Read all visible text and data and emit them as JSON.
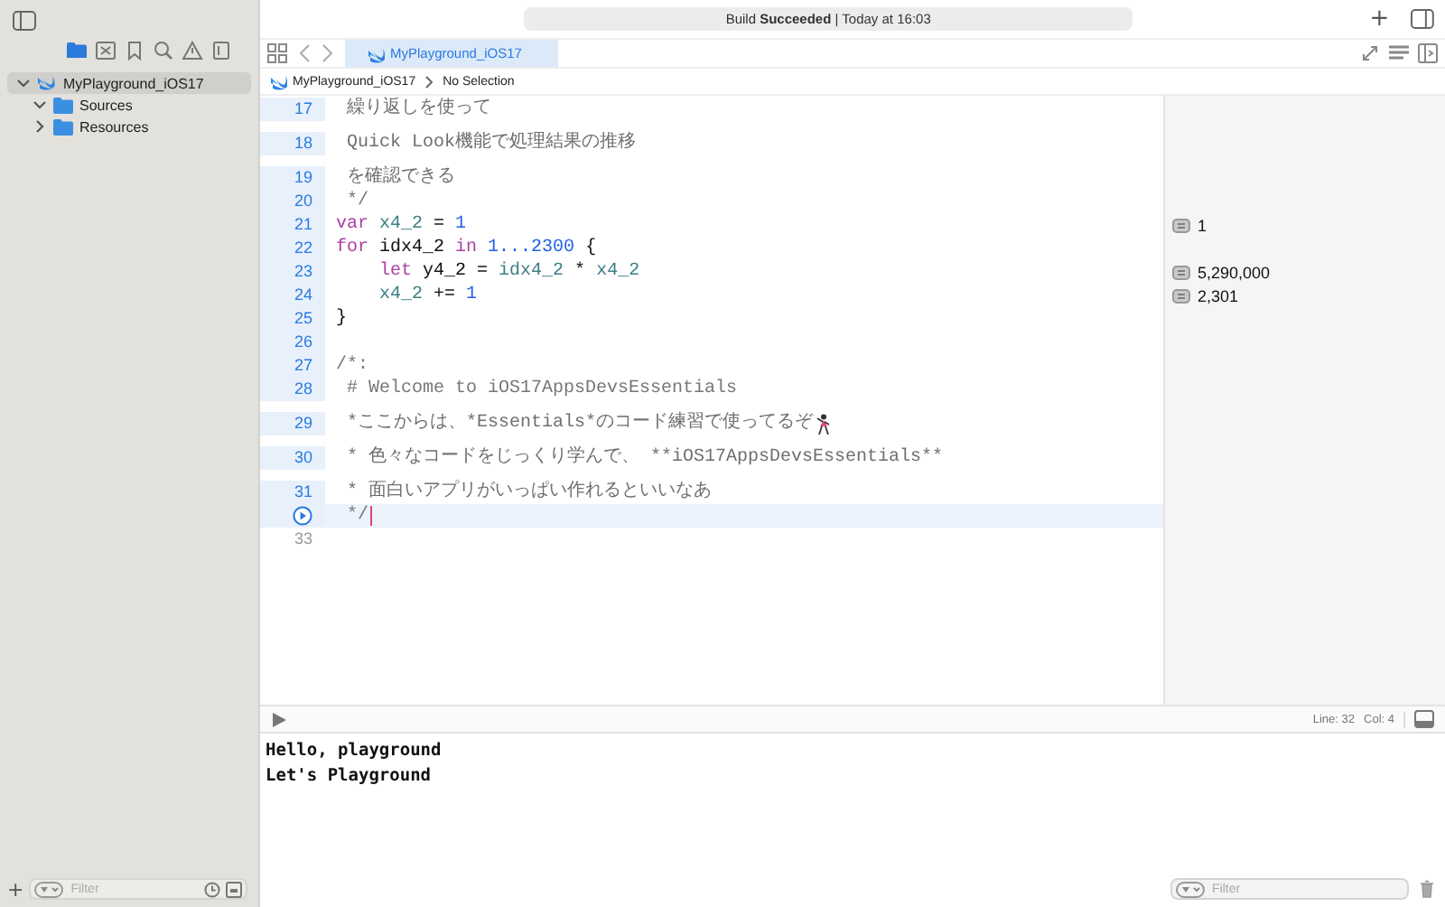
{
  "toolbar": {
    "status": "Build **Succeeded** | Today at 16:03",
    "add": "+"
  },
  "navigator": {
    "tabs": [
      {
        "kind": "files",
        "selected": true
      },
      {
        "kind": "source-control",
        "selected": false
      },
      {
        "kind": "bookmarks",
        "selected": false
      },
      {
        "kind": "find",
        "selected": false
      },
      {
        "kind": "issues",
        "selected": false
      },
      {
        "kind": "tests",
        "selected": false
      }
    ],
    "items": [
      {
        "label": "MyPlayground_iOS17",
        "kind": "project",
        "selected": true,
        "expanded": true,
        "children": [
          {
            "label": "Sources",
            "kind": "folder",
            "selected": false,
            "expanded": true
          },
          {
            "label": "Resources",
            "kind": "folder",
            "selected": false,
            "expanded": false
          }
        ]
      }
    ],
    "add": "+",
    "filter": {
      "placeholder": "Filter"
    }
  },
  "tabs": [
    {
      "label": "MyPlayground_iOS17",
      "selected": true
    }
  ],
  "breadcrumb": [
    "MyPlayground_iOS17",
    "No Selection"
  ],
  "editor": {
    "lines": [
      {
        "number": "17",
        "kind": "doc",
        "executed": true,
        "tokens": [
          {
            "kind": "doc",
            "text": "繰り返しを使って"
          }
        ]
      },
      {
        "number": "18",
        "kind": "doc",
        "executed": true,
        "tokens": [
          {
            "kind": "doc",
            "text": "Quick Look機能で処理結果の推移"
          }
        ]
      },
      {
        "number": "19",
        "kind": "doc",
        "executed": true,
        "tokens": [
          {
            "kind": "doc",
            "text": "を確認できる"
          }
        ]
      },
      {
        "number": "20",
        "kind": "comment",
        "executed": true,
        "tokens": [
          {
            "kind": "comment",
            "text": "*/"
          }
        ]
      },
      {
        "number": "21",
        "kind": "code",
        "executed": true,
        "result": "1",
        "tokens": [
          {
            "kind": "keyword",
            "text": "var "
          },
          {
            "kind": "ident",
            "text": "x4_2"
          },
          {
            "kind": "plain",
            "text": " = "
          },
          {
            "kind": "number",
            "text": "1"
          }
        ]
      },
      {
        "number": "22",
        "kind": "code",
        "executed": true,
        "tokens": [
          {
            "kind": "keyword",
            "text": "for"
          },
          {
            "kind": "plain",
            "text": " idx4_2 "
          },
          {
            "kind": "keyword",
            "text": "in "
          },
          {
            "kind": "number",
            "text": "1...2300"
          },
          {
            "kind": "plain",
            "text": " {"
          }
        ]
      },
      {
        "number": "23",
        "kind": "code",
        "executed": true,
        "result": "5,290,000",
        "tokens": [
          {
            "kind": "keyword",
            "text": "    let"
          },
          {
            "kind": "plain",
            "text": " y4_2 = "
          },
          {
            "kind": "ident",
            "text": "idx4_2"
          },
          {
            "kind": "plain",
            "text": " * "
          },
          {
            "kind": "ident",
            "text": "x4_2"
          }
        ]
      },
      {
        "number": "24",
        "kind": "code",
        "executed": true,
        "result": "2,301",
        "tokens": [
          {
            "kind": "ident",
            "text": "    x4_2"
          },
          {
            "kind": "plain",
            "text": " += "
          },
          {
            "kind": "number",
            "text": "1"
          }
        ]
      },
      {
        "number": "25",
        "kind": "code",
        "executed": true,
        "tokens": [
          {
            "kind": "plain",
            "text": "}"
          }
        ]
      },
      {
        "number": "26",
        "kind": "code",
        "executed": true
      },
      {
        "number": "27",
        "kind": "code",
        "executed": true,
        "tokens": [
          {
            "kind": "comment",
            "text": "/*:"
          }
        ]
      },
      {
        "number": "28",
        "kind": "comment",
        "executed": true,
        "tokens": [
          {
            "kind": "comment",
            "text": "# Welcome to iOS17AppsDevsEssentials"
          }
        ]
      },
      {
        "number": "29",
        "kind": "doc",
        "executed": true,
        "tokens": [
          {
            "kind": "doc",
            "text": "*ここからは、*Essentials*のコード練習で使ってるぞ"
          },
          {
            "kind": "figure"
          }
        ]
      },
      {
        "number": "30",
        "kind": "doc",
        "executed": true,
        "tokens": [
          {
            "kind": "doc",
            "text": "* 色々なコードをじっくり学んで、 **iOS17AppsDevsEssentials**"
          }
        ]
      },
      {
        "number": "31",
        "kind": "doc",
        "executed": true,
        "tokens": [
          {
            "kind": "doc",
            "text": "* 面白いアプリがいっぱい作れるといいなあ"
          }
        ]
      },
      {
        "kind": "comment",
        "current": true,
        "executed": true,
        "tokens": [
          {
            "kind": "comment",
            "text": "*/"
          }
        ]
      },
      {
        "number": "33",
        "kind": "code",
        "executed": false
      }
    ]
  },
  "status": {
    "line": "Line: 32",
    "col": "Col: 4"
  },
  "console": {
    "output": [
      "Hello, playground",
      "Let's Playground"
    ],
    "filter": {
      "placeholder": "Filter"
    }
  }
}
